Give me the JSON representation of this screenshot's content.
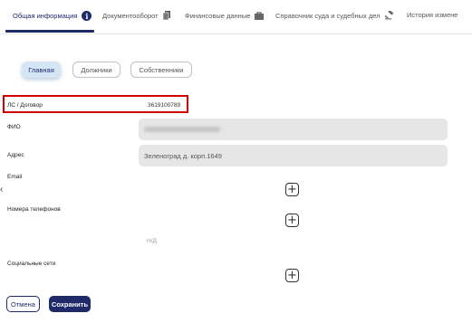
{
  "tabs": [
    {
      "label": "Общая информация",
      "icon": "info-icon",
      "active": true
    },
    {
      "label": "Документооборот",
      "icon": "document-icon"
    },
    {
      "label": "Финансовые данные",
      "icon": "briefcase-icon"
    },
    {
      "label": "Справочник суда и судебных дел",
      "icon": "gavel-icon"
    },
    {
      "label": "История измене",
      "icon": ""
    }
  ],
  "subtabs": [
    {
      "label": "Главная",
      "active": true
    },
    {
      "label": "Должники"
    },
    {
      "label": "Собственники"
    }
  ],
  "form": {
    "account_label": "ЛС / Договор",
    "account_value": "3619100789",
    "fio_label": "ФИО",
    "address_label": "Адрес",
    "address_value": "Зеленоград д. корп.1649",
    "email_label": "Email",
    "phones_label": "Номера телефонов",
    "phones_placeholder": "Н/Д",
    "social_label": "Социальные сети"
  },
  "buttons": {
    "cancel": "Отмена",
    "save": "Сохранить"
  },
  "colors": {
    "primary": "#1f2a6b",
    "highlight": "#d00000",
    "field_bg": "#e6e6e6",
    "active_subtab_bg": "#d4e5f6"
  }
}
